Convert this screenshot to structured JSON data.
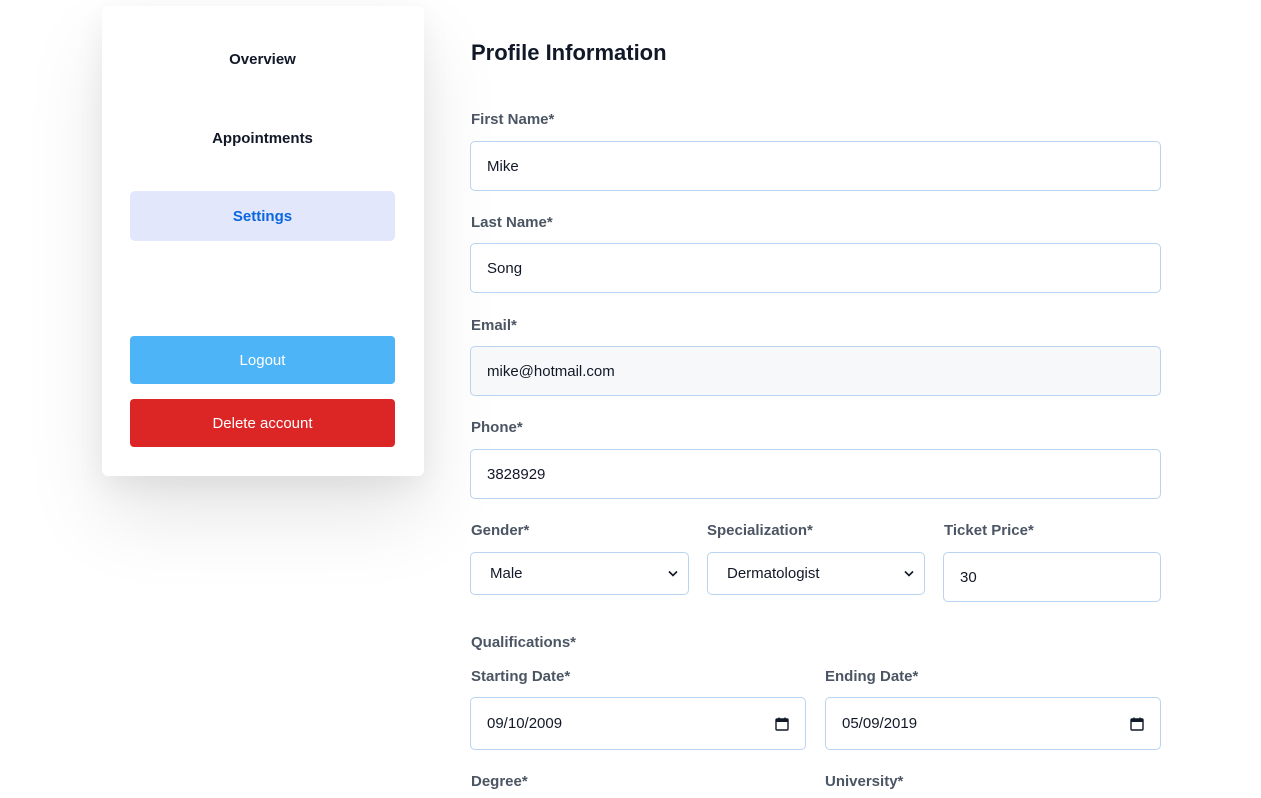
{
  "sidebar": {
    "items": [
      {
        "label": "Overview"
      },
      {
        "label": "Appointments"
      },
      {
        "label": "Settings",
        "active": true
      }
    ],
    "logout_label": "Logout",
    "delete_label": "Delete account"
  },
  "form": {
    "title": "Profile Information",
    "first_name": {
      "label": "First Name*",
      "value": "Mike"
    },
    "last_name": {
      "label": "Last Name*",
      "value": "Song"
    },
    "email": {
      "label": "Email*",
      "value": "mike@hotmail.com"
    },
    "phone": {
      "label": "Phone*",
      "value": "3828929"
    },
    "gender": {
      "label": "Gender*",
      "value": "Male"
    },
    "specialization": {
      "label": "Specialization*",
      "value": "Dermatologist"
    },
    "ticket_price": {
      "label": "Ticket Price*",
      "value": "30"
    },
    "qualifications": {
      "label": "Qualifications*",
      "starting_date": {
        "label": "Starting Date*",
        "value": "09/10/2009"
      },
      "ending_date": {
        "label": "Ending Date*",
        "value": "05/09/2019"
      },
      "degree": {
        "label": "Degree*"
      },
      "university": {
        "label": "University*"
      }
    }
  },
  "colors": {
    "active_bg": "#e2e7fb",
    "active_text": "#0a67e0",
    "logout_bg": "#4db4f7",
    "delete_bg": "#dc2626",
    "border": "#b9d3f0"
  },
  "icons": {
    "select": "chevron-down-icon",
    "date": "calendar-icon"
  }
}
